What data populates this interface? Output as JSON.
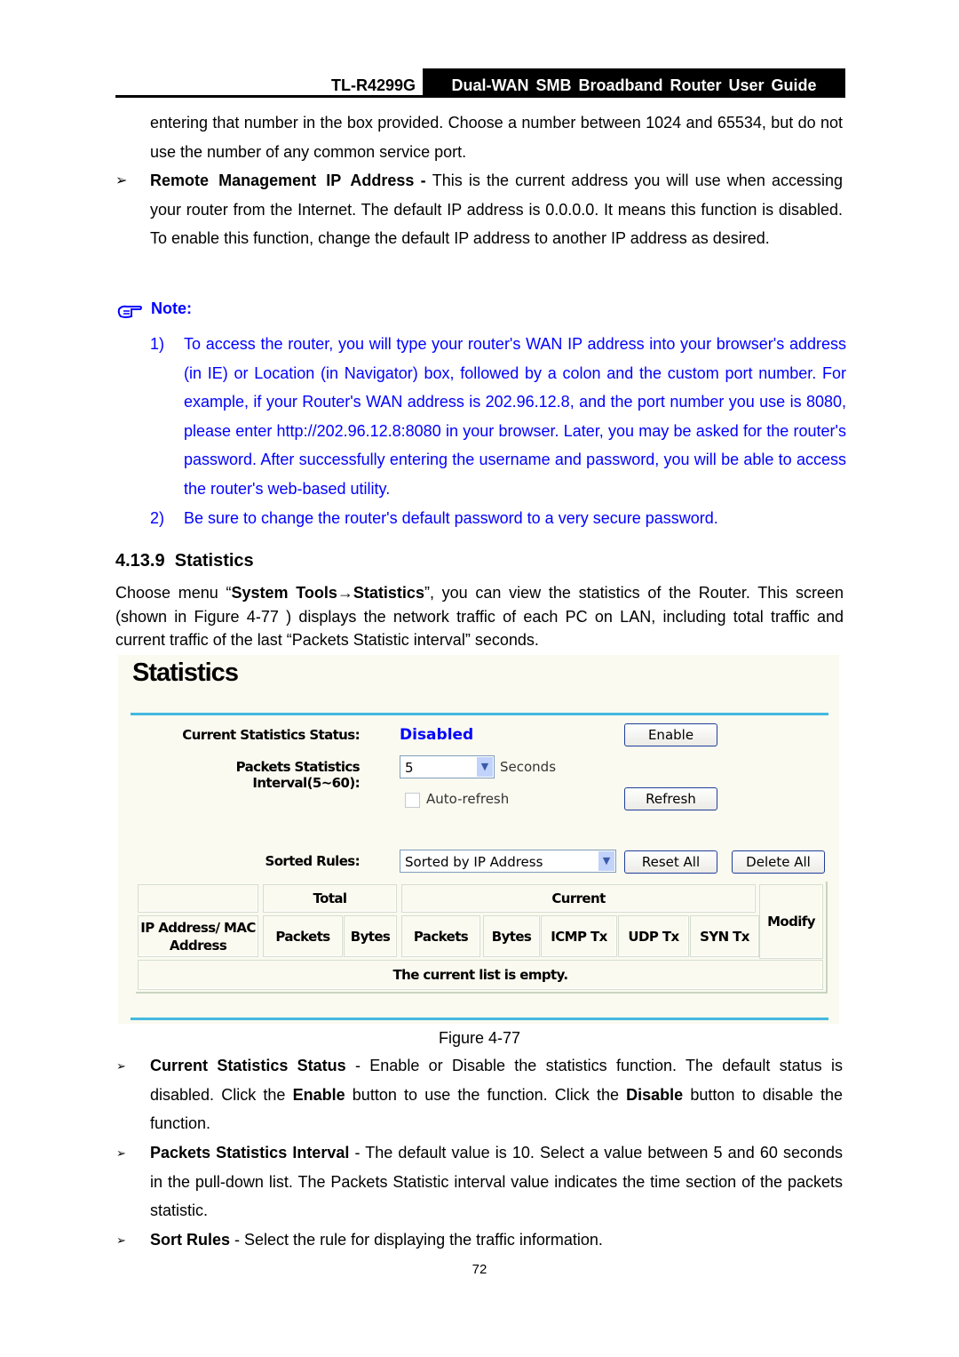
{
  "header": {
    "model": "TL-R4299G",
    "title": "Dual-WAN SMB Broadband Router User Guide"
  },
  "intro": "entering that number in the box provided. Choose a number between 1024 and 65534, but do not use the number of any common service port.",
  "remote": {
    "term": "Remote Management IP Address",
    "dash": " - ",
    "text": "This is the current address you will use when accessing your router from the Internet. The default IP address is 0.0.0.0. It means this function is disabled. To enable this function, change the default IP address to another IP address as desired."
  },
  "note": {
    "label": "Note:",
    "items": [
      {
        "num": "1)",
        "text": "To access the router, you will type your router's WAN IP address into your browser's address (in IE) or Location (in Navigator) box, followed by a colon and the custom port number. For example, if your Router's WAN address is 202.96.12.8, and the port number you use is 8080, please enter http://202.96.12.8:8080 in your browser. Later, you may be asked for the router's password. After successfully entering the username and password, you will be able to access the router's web-based utility."
      },
      {
        "num": "2)",
        "text": "Be sure to change the router's default password to a very secure password."
      }
    ]
  },
  "section": {
    "number": "4.13.9",
    "title": "Statistics"
  },
  "section_para": {
    "p1": "Choose menu “",
    "b1": "System Tools→Statistics",
    "p2": "”, you can view the statistics of the Router. This screen (shown in Figure 4-77 ) displays the network traffic of each PC on LAN, including total traffic and current traffic of the last “Packets Statistic interval” seconds."
  },
  "screen": {
    "title": "Statistics",
    "status_label": "Current Statistics Status:",
    "status_value": "Disabled",
    "enable_btn": "Enable",
    "interval_label": "Packets Statistics Interval(5~60):",
    "interval_value": "5",
    "seconds": "Seconds",
    "autorefresh": "Auto-refresh",
    "autorefresh_checked": false,
    "refresh_btn": "Refresh",
    "sorted_label": "Sorted Rules:",
    "sorted_value": "Sorted by IP Address",
    "reset_btn": "Reset All",
    "delete_btn": "Delete All",
    "table": {
      "total": "Total",
      "current": "Current",
      "modify": "Modify",
      "ip_mac": "IP Address/ MAC Address",
      "cols": [
        "Packets",
        "Bytes",
        "Packets",
        "Bytes",
        "ICMP Tx",
        "UDP Tx",
        "SYN Tx"
      ],
      "empty": "The current list is empty."
    },
    "colors": {
      "accent_line": "#44b8e0",
      "status": "#0000ff",
      "background": "#fafaf0"
    }
  },
  "caption": "Figure 4-77",
  "bullets": [
    {
      "term": "Current Statistics Status",
      "parts": [
        " - Enable or Disable the statistics function. The default status is disabled. Click the ",
        "Enable",
        " button to use the function. Click the ",
        "Disable",
        " button to disable the function."
      ]
    },
    {
      "term": "Packets Statistics Interval",
      "text": " - The default value is 10. Select a value between 5 and 60 seconds in the pull-down list. The Packets Statistic interval value indicates the time section of the packets statistic."
    },
    {
      "term": "Sort Rules",
      "text": " - Select the rule for displaying the traffic information."
    }
  ],
  "page_number": "72"
}
